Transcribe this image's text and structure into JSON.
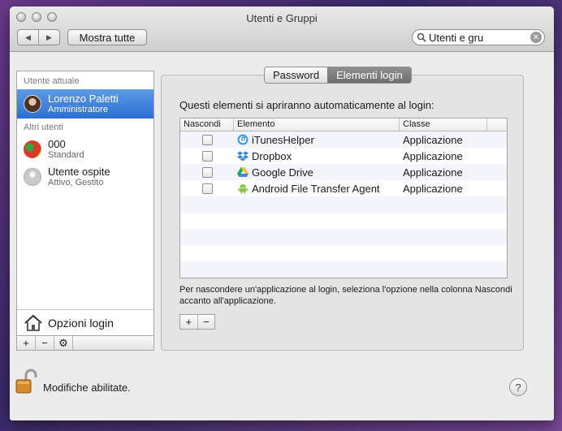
{
  "window": {
    "title": "Utenti e Gruppi"
  },
  "toolbar": {
    "back_glyph": "◀",
    "forward_glyph": "▶",
    "show_all_label": "Mostra tutte",
    "search_value": "Utenti e gru"
  },
  "sidebar": {
    "current_section": "Utente attuale",
    "current_user": {
      "name": "Lorenzo Paletti",
      "role": "Amministratore",
      "avatar_icon": "user-photo-avatar"
    },
    "other_section": "Altri utenti",
    "other_users": [
      {
        "name": "000",
        "role": "Standard",
        "avatar_icon": "parrot-avatar"
      },
      {
        "name": "Utente ospite",
        "role": "Attivo, Gestito",
        "avatar_icon": "generic-user-avatar"
      }
    ],
    "login_options_label": "Opzioni login",
    "tools": [
      "+",
      "−",
      "⚙"
    ]
  },
  "tabs": [
    {
      "label": "Password",
      "active": false
    },
    {
      "label": "Elementi login",
      "active": true
    }
  ],
  "main": {
    "intro": "Questi elementi si apriranno automaticamente al login:",
    "columns": [
      "Nascondi",
      "Elemento",
      "Classe"
    ],
    "rows": [
      {
        "hide": false,
        "element": "iTunesHelper",
        "icon": "itunes-icon",
        "class": "Applicazione"
      },
      {
        "hide": false,
        "element": "Dropbox",
        "icon": "dropbox-icon",
        "class": "Applicazione"
      },
      {
        "hide": false,
        "element": "Google Drive",
        "icon": "google-drive-icon",
        "class": "Applicazione"
      },
      {
        "hide": false,
        "element": "Android File Transfer Agent",
        "icon": "android-icon",
        "class": "Applicazione"
      }
    ],
    "note": "Per nascondere un'applicazione al login, seleziona l'opzione nella colonna Nascondi accanto all'applicazione.",
    "add_label": "+",
    "remove_label": "−"
  },
  "footer": {
    "lock_text": "Modifiche abilitate.",
    "help_label": "?"
  },
  "colors": {
    "selection": "#2c6fd0",
    "active_tab": "#7a7a7a"
  }
}
